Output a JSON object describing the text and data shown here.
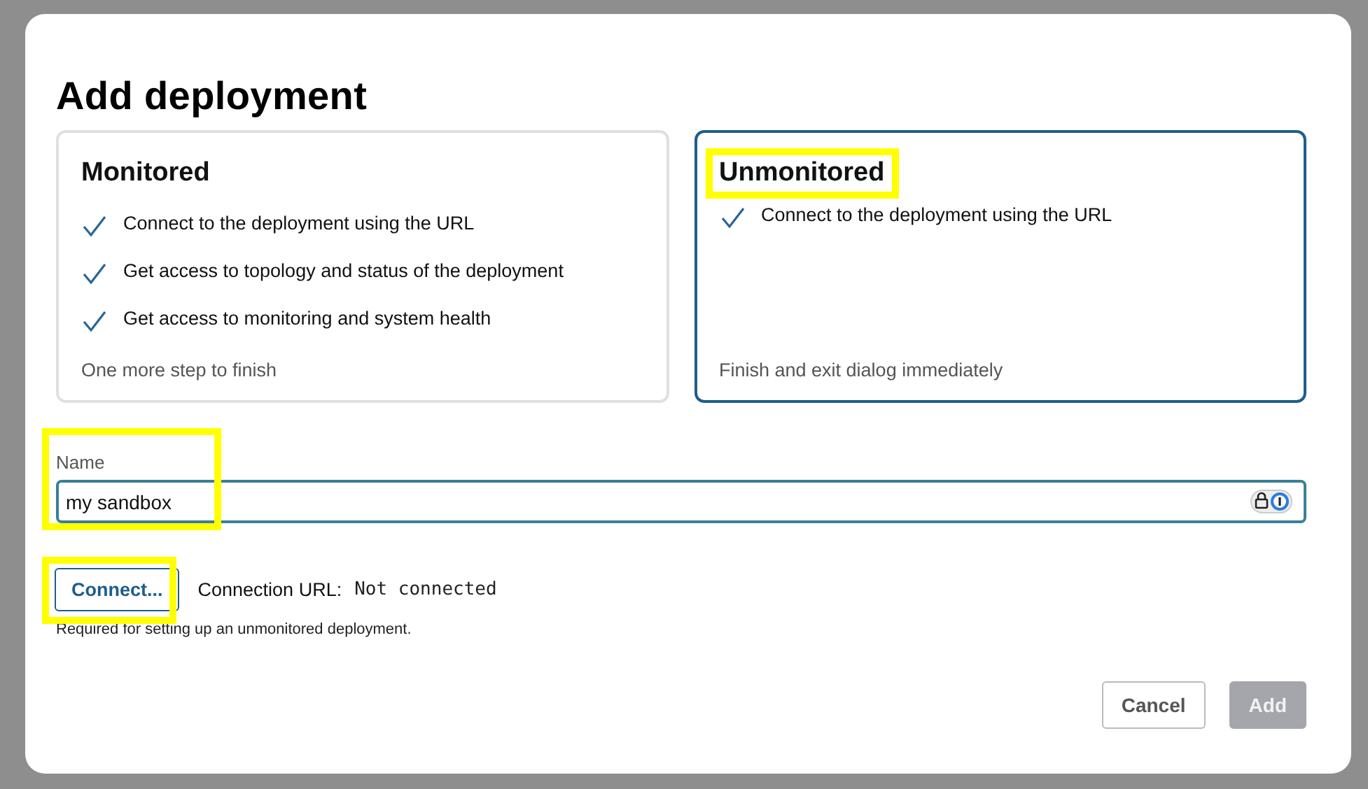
{
  "dialog": {
    "title": "Add deployment"
  },
  "options": [
    {
      "title": "Monitored",
      "selected": false,
      "highlighted": false,
      "features": [
        "Connect to the deployment using the URL",
        "Get access to topology and status of the deployment",
        "Get access to monitoring and system health"
      ],
      "note": "One more step to finish"
    },
    {
      "title": "Unmonitored",
      "selected": true,
      "highlighted": true,
      "features": [
        "Connect to the deployment using the URL"
      ],
      "note": "Finish and exit dialog immediately"
    }
  ],
  "name_field": {
    "label": "Name",
    "value": "my sandbox",
    "highlighted": true
  },
  "connection": {
    "button": "Connect...",
    "button_highlighted": true,
    "label": "Connection URL:",
    "value": "Not connected",
    "hint": "Required for setting up an unmonitored deployment."
  },
  "buttons": [
    {
      "label": "Cancel",
      "disabled": false
    },
    {
      "label": "Add",
      "disabled": true
    }
  ]
}
